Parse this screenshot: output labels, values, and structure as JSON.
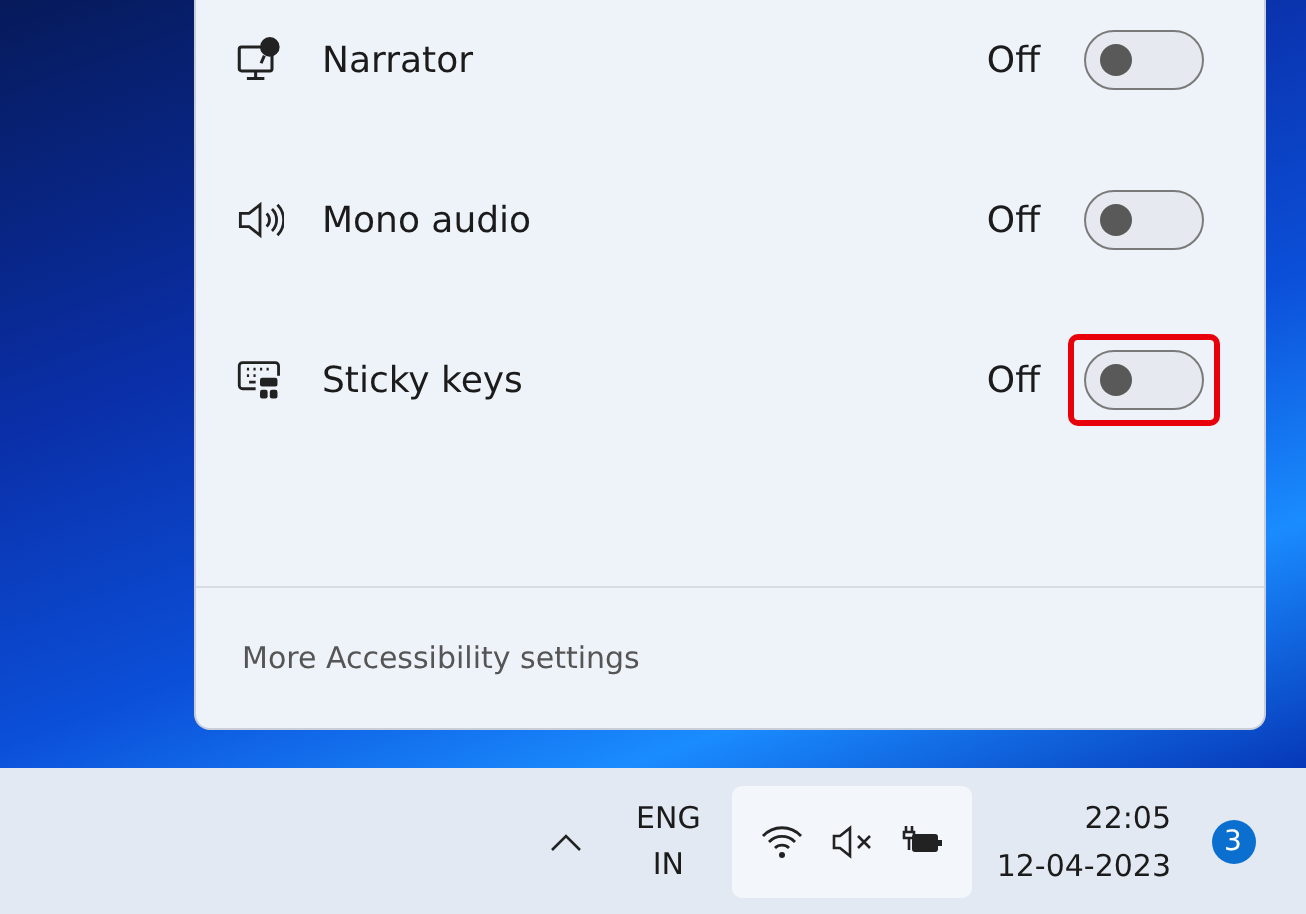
{
  "quick_settings_panel": {
    "items": [
      {
        "kind": "narrator",
        "label": "Narrator",
        "state_text": "Off",
        "on": false,
        "highlighted": false
      },
      {
        "kind": "mono-audio",
        "label": "Mono audio",
        "state_text": "Off",
        "on": false,
        "highlighted": false
      },
      {
        "kind": "sticky-keys",
        "label": "Sticky keys",
        "state_text": "Off",
        "on": false,
        "highlighted": true
      }
    ],
    "footer_link": "More Accessibility settings"
  },
  "taskbar": {
    "language": {
      "line1": "ENG",
      "line2": "IN"
    },
    "clock": {
      "time": "22:05",
      "date": "12-04-2023"
    },
    "notification_badge": "3"
  }
}
